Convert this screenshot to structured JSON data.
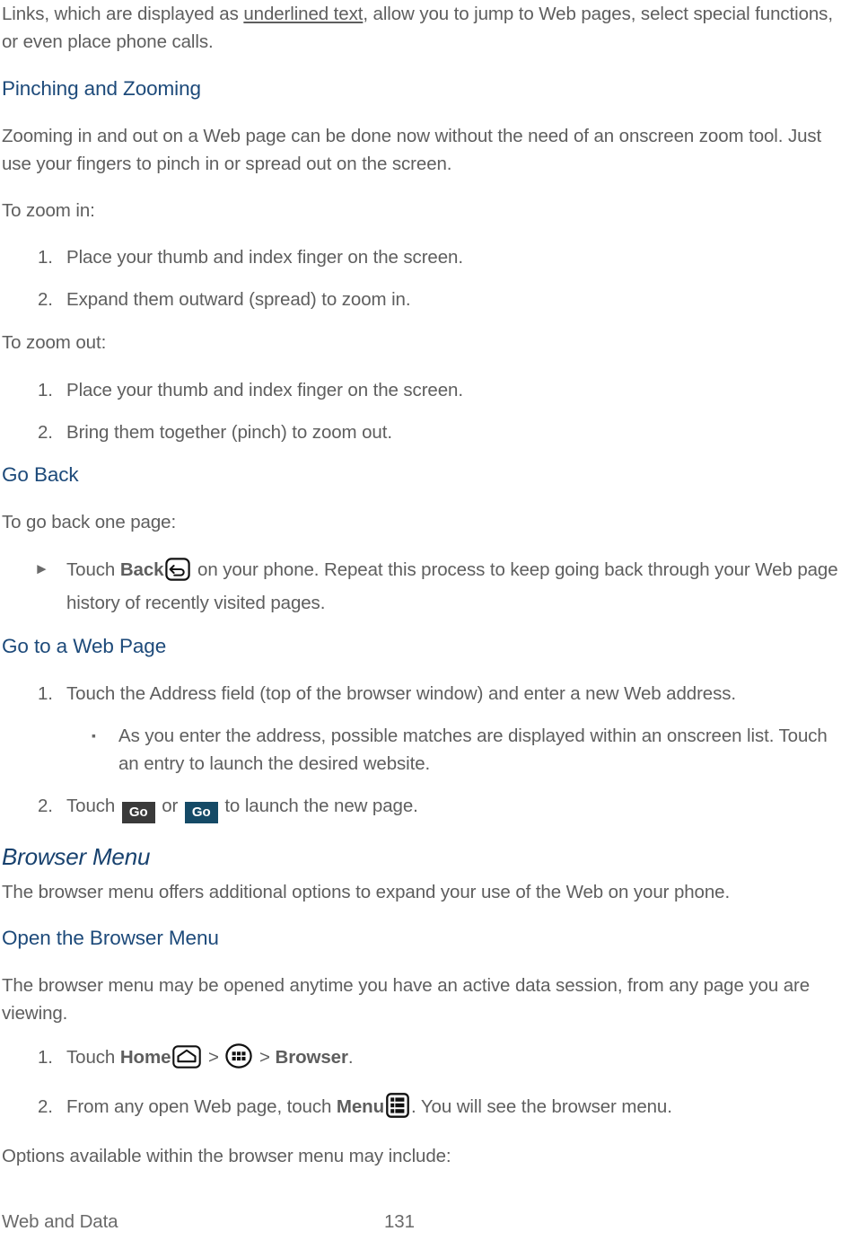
{
  "document": {
    "colors": {
      "body_text": "#5e5e5e",
      "heading_blue": "#1d4a7a",
      "section_blue": "#17416e",
      "go_dark": "#3a3a3a",
      "go_blue": "#154a66"
    }
  },
  "content": {
    "intro_para": {
      "pre": "Links, which are displayed as ",
      "underlined": "underlined text",
      "post": ", allow you to jump to Web pages, select special functions, or even place phone calls."
    },
    "pinching_heading": "Pinching and Zooming",
    "pinching_para": "Zooming in and out on a Web page can be done now without the need of an onscreen zoom tool. Just use your fingers to pinch in or spread out on the screen.",
    "zoom_in_lead": "To zoom in:",
    "zoom_in_steps": [
      {
        "marker": "1.",
        "text": "Place your thumb and index finger on the screen."
      },
      {
        "marker": "2.",
        "text": "Expand them outward (spread) to zoom in."
      }
    ],
    "zoom_out_lead": "To zoom out:",
    "zoom_out_steps": [
      {
        "marker": "1.",
        "text": "Place your thumb and index finger on the screen."
      },
      {
        "marker": "2.",
        "text": "Bring them together (pinch) to zoom out."
      }
    ],
    "go_back_heading": "Go Back",
    "go_back_lead": "To go back one page:",
    "go_back_item": {
      "marker": "►",
      "pre": "Touch ",
      "bold": "Back",
      "icon": "back-arrow-icon",
      "post": " on your phone. Repeat this process to keep going back through your Web page history of recently visited pages."
    },
    "goto_heading": "Go to a Web Page",
    "goto_step1": {
      "marker": "1.",
      "text": "Touch the Address field (top of the browser window) and enter a new Web address."
    },
    "goto_sub1": {
      "marker": "▪",
      "text": "As you enter the address, possible matches are displayed within an onscreen list. Touch an entry to launch the desired website."
    },
    "goto_step2": {
      "marker": "2.",
      "pre": "Touch ",
      "go_dark_label": "Go",
      "mid": " or ",
      "go_blue_label": "Go",
      "post": " to launch the new page."
    },
    "browser_menu_heading": "Browser Menu",
    "browser_menu_para": "The browser menu offers additional options to expand your use of the Web on your phone.",
    "open_menu_heading": "Open the Browser Menu",
    "open_menu_para": "The browser menu may be opened anytime you have an active data session, from any page you are viewing.",
    "open_menu_step1": {
      "marker": "1.",
      "pre": "Touch ",
      "bold_home": "Home",
      "home_icon": "home-icon",
      "sep1": " > ",
      "apps_icon": "apps-grid-icon",
      "sep2": " > ",
      "bold_browser": "Browser",
      "post": "."
    },
    "open_menu_step2": {
      "marker": "2.",
      "pre": "From any open Web page, touch ",
      "bold_menu": "Menu",
      "menu_icon": "menu-list-icon",
      "post": ". You will see the browser menu."
    },
    "options_lead": "Options available within the browser menu may include:"
  },
  "footer": {
    "chapter": "Web and Data",
    "page_number": "131"
  }
}
